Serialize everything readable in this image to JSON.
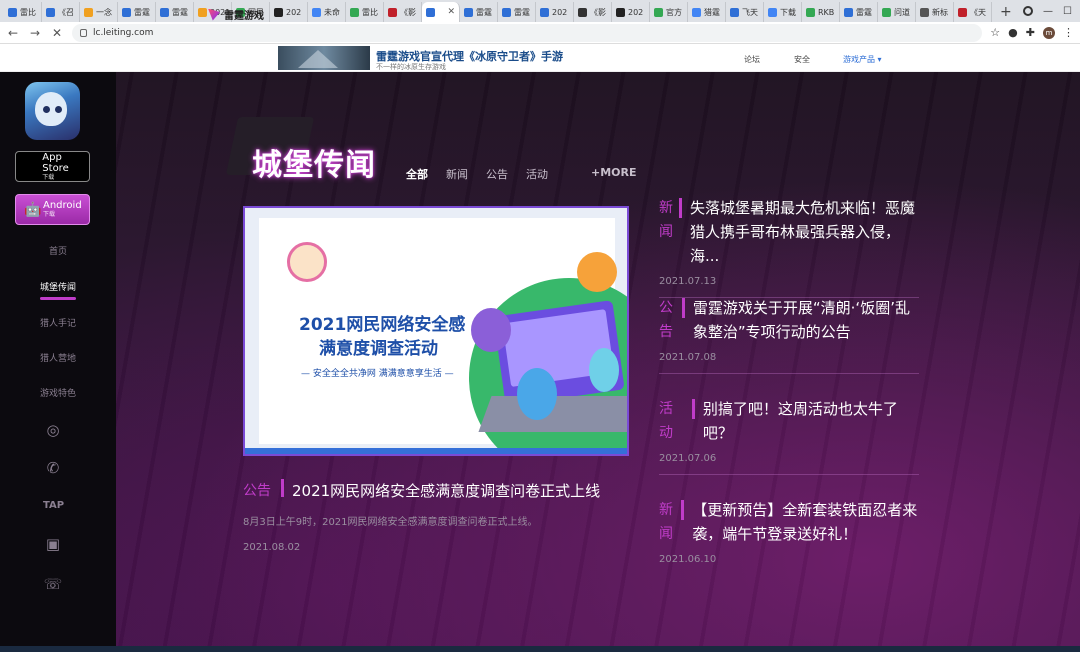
{
  "browser": {
    "tabs": [
      {
        "label": "雷比",
        "color": "#2f6fd6"
      },
      {
        "label": "《召",
        "color": "#2f6fd6"
      },
      {
        "label": "一念",
        "color": "#f0a020"
      },
      {
        "label": "雷霆",
        "color": "#2f6fd6"
      },
      {
        "label": "雷霆",
        "color": "#2f6fd6"
      },
      {
        "label": "2021",
        "color": "#f0a020"
      },
      {
        "label": "网民",
        "color": "#34a853"
      },
      {
        "label": "202",
        "color": "#222222"
      },
      {
        "label": "未命",
        "color": "#4285f4"
      },
      {
        "label": "雷比",
        "color": "#34a853"
      },
      {
        "label": "《影",
        "color": "#c0202a"
      },
      {
        "label": "",
        "color": "#2f6fd6"
      },
      {
        "label": "雷霆",
        "color": "#2f6fd6"
      },
      {
        "label": "雷霆",
        "color": "#2f6fd6"
      },
      {
        "label": "202",
        "color": "#2f6fd6"
      },
      {
        "label": "《影",
        "color": "#333333"
      },
      {
        "label": "202",
        "color": "#222222"
      },
      {
        "label": "官方",
        "color": "#34a853"
      },
      {
        "label": "猎霆",
        "color": "#4285f4"
      },
      {
        "label": "飞天",
        "color": "#2f6fd6"
      },
      {
        "label": "下载",
        "color": "#4285f4"
      },
      {
        "label": "RKB",
        "color": "#34a853"
      },
      {
        "label": "雷霆",
        "color": "#2f6fd6"
      },
      {
        "label": "问道",
        "color": "#34a853"
      },
      {
        "label": "新标",
        "color": "#555555"
      },
      {
        "label": "《天",
        "color": "#c0202a"
      }
    ],
    "url": "lc.leiting.com",
    "profile_initial": "m"
  },
  "site_header": {
    "logo_text": "雷霆游戏",
    "banner_title": "雷霆游戏官宣代理《冰原守卫者》手游",
    "banner_subtitle": "不一样的冰原生存游戏",
    "links": [
      "论坛",
      "安全",
      "游戏产品 ▾"
    ]
  },
  "sidebar": {
    "appstore_label": "App Store",
    "appstore_sub": "下载",
    "android_label": "Android",
    "android_sub": "下载",
    "nav": [
      "首页",
      "城堡传闻",
      "猎人手记",
      "猎人营地",
      "游戏特色"
    ],
    "active_nav": "城堡传闻",
    "social_icons": [
      "weibo-icon",
      "chat-icon",
      "taptap-icon",
      "bilibili-icon",
      "phone-icon"
    ]
  },
  "section": {
    "title": "城堡传闻",
    "tabs": [
      "全部",
      "新闻",
      "公告",
      "活动"
    ],
    "active_tab": "全部",
    "more": "+MORE"
  },
  "hero": {
    "line1": "2021网民网络安全感",
    "line2": "满意度调查活动",
    "slogan": "— 安全全全共净网  满满意意享生活 —"
  },
  "main_news": {
    "category": "公告",
    "title": "2021网民网络安全感满意度调查问卷正式上线",
    "desc": "8月3日上午9时，2021网民网络安全感满意度调查问卷正式上线。",
    "date": "2021.08.02"
  },
  "news_list": [
    {
      "category": "新闻",
      "title": "失落城堡暑期最大危机来临！恶魔猎人携手哥布林最强兵器入侵，海...",
      "date": "2021.07.13"
    },
    {
      "category": "公告",
      "title": "雷霆游戏关于开展“清朗·‘饭圈’乱象整治”专项行动的公告",
      "date": "2021.07.08"
    },
    {
      "category": "活动",
      "title": "别搞了吧！这周活动也太牛了吧？",
      "date": "2021.07.06"
    },
    {
      "category": "新闻",
      "title": "【更新预告】全新套装铁面忍者来袭，端午节登录送好礼！",
      "date": "2021.06.10"
    }
  ]
}
